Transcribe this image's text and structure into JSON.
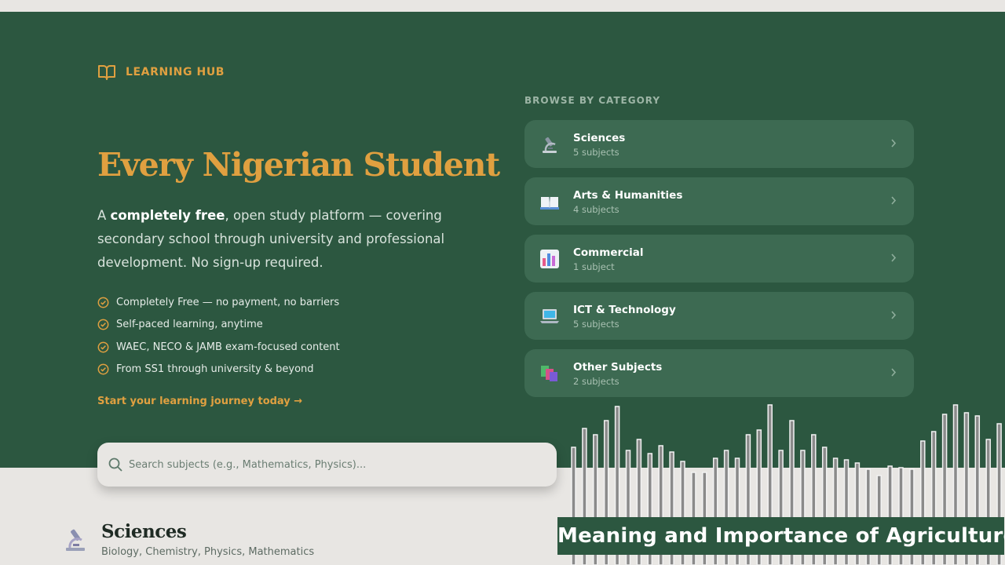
{
  "brand": {
    "label": "LEARNING HUB",
    "icon": "open-book-icon",
    "color": "#e0a040"
  },
  "hero": {
    "headline": "Every Nigerian Student",
    "intro_prefix": "A ",
    "intro_bold": "completely free",
    "intro_rest": ", open study platform — covering secondary school through university and professional development. No sign-up required.",
    "features": [
      "Completely Free — no payment, no barriers",
      "Self-paced learning, anytime",
      "WAEC, NECO & JAMB exam-focused content",
      "From SS1 through university & beyond"
    ],
    "cta": "Start your learning journey today →"
  },
  "browse": {
    "title": "BROWSE BY CATEGORY",
    "categories": [
      {
        "name": "Sciences",
        "count": "5 subjects",
        "icon": "microscope-icon"
      },
      {
        "name": "Arts & Humanities",
        "count": "4 subjects",
        "icon": "book-icon"
      },
      {
        "name": "Commercial",
        "count": "1 subject",
        "icon": "bar-chart-icon"
      },
      {
        "name": "ICT & Technology",
        "count": "5 subjects",
        "icon": "laptop-icon"
      },
      {
        "name": "Other Subjects",
        "count": "2 subjects",
        "icon": "books-stack-icon"
      }
    ]
  },
  "search": {
    "placeholder": "Search subjects (e.g., Mathematics, Physics)..."
  },
  "section": {
    "title": "Sciences",
    "subtitle": "Biology, Chemistry, Physics, Mathematics",
    "icon": "microscope-icon"
  },
  "overlay": {
    "title": "Meaning and Importance of Agriculture"
  },
  "colors": {
    "hero_bg": "#2c5740",
    "accent": "#e0a040",
    "card_bg": "#3d6a52",
    "page_bg": "#e8e6e3"
  }
}
